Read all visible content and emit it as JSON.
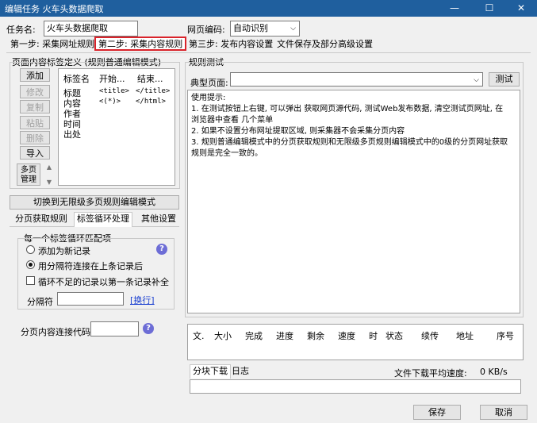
{
  "window": {
    "title": "编辑任务 火车头数据爬取",
    "min_glyph": "—",
    "max_glyph": "☐",
    "close_glyph": "✕"
  },
  "task": {
    "name_label": "任务名:",
    "name_value": "火车头数据爬取",
    "encoding_label": "网页编码:",
    "encoding_value": "自动识别"
  },
  "steps": [
    "第一步: 采集网址规则",
    "第二步: 采集内容规则",
    "第三步: 发布内容设置",
    "文件保存及部分高级设置"
  ],
  "left": {
    "section_title": "页面内容标签定义 (规则普通编辑模式)",
    "buttons": {
      "add": "添加",
      "edit": "修改",
      "copy": "复制",
      "paste": "粘贴",
      "delete": "删除",
      "import": "导入",
      "multi_page": "多页管理"
    },
    "table": {
      "headers": [
        "标签名",
        "开始...",
        "结束..."
      ],
      "rows": [
        [
          "标题",
          "<title>",
          "</title>"
        ],
        [
          "内容",
          "<(*)>",
          "</html>"
        ],
        [
          "作者",
          "",
          ""
        ],
        [
          "时间",
          "",
          ""
        ],
        [
          "出处",
          "",
          ""
        ]
      ]
    },
    "switch_button": "切换到无限级多页规则编辑模式",
    "subtabs": [
      "分页获取规则",
      "标签循环处理",
      "其他设置"
    ],
    "loop_group_title": "每一个标签循环匹配项",
    "radio_new": "添加为新记录",
    "radio_join": "用分隔符连接在上条记录后",
    "check_fill": "循环不足的记录以第一条记录补全",
    "separator_label": "分隔符",
    "newline_link": "[换行]",
    "page_join_label": "分页内容连接代码"
  },
  "right": {
    "section_title": "规则测试",
    "typical_page_label": "典型页面:",
    "typical_page_value": "",
    "test_button": "测试",
    "tips": [
      "使用提示:",
      "1. 在测试按钮上右键, 可以弹出 获取网页源代码, 测试Web发布数据, 清空测试页网址, 在",
      "浏览器中查看 几个菜单",
      "2. 如果不设置分布网址提取区域, 则采集器不会采集分页内容",
      "3. 规则普通编辑模式中的分页获取规则和无限级多页规则编辑模式中的0级的分页网址获取",
      "规则是完全一致的。"
    ],
    "download_headers": [
      "文.",
      "大小",
      "完成",
      "进度",
      "剩余",
      "速度",
      "时",
      "状态",
      "续传",
      "地址",
      "序号"
    ],
    "bottom_tabs": [
      "分块下载",
      "日志"
    ],
    "avg_speed_label": "文件下载平均速度:",
    "avg_speed_value": "0 KB/s"
  },
  "footer": {
    "save": "保存",
    "cancel": "取消"
  }
}
